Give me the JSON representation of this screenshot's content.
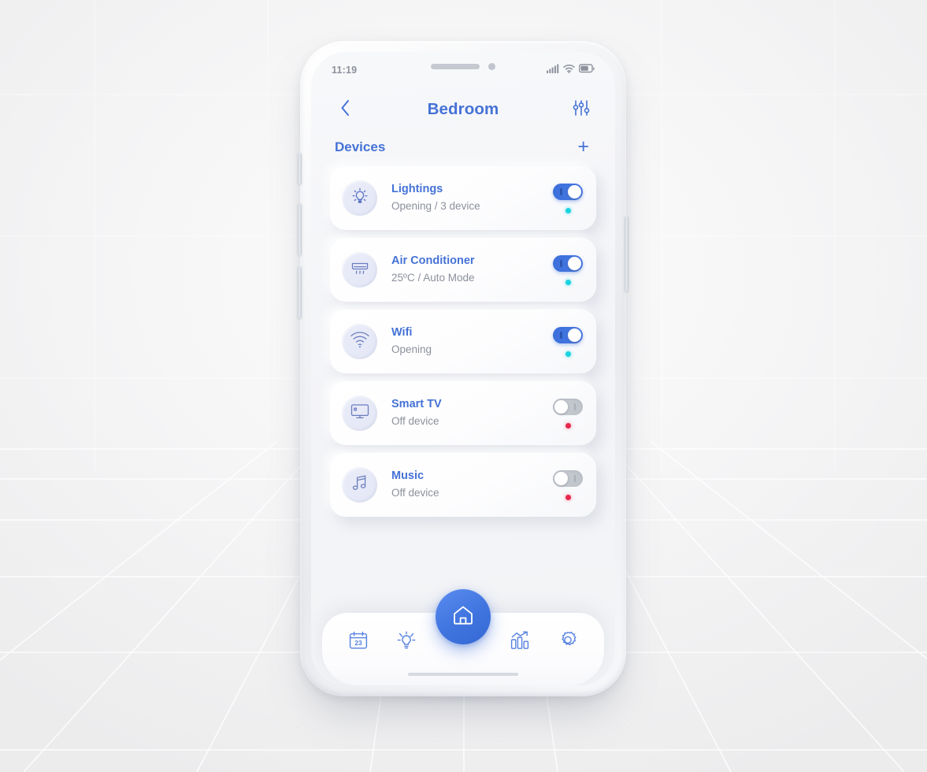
{
  "status_bar": {
    "time": "11:19",
    "icons": [
      "signal-icon",
      "wifi-icon",
      "battery-icon"
    ]
  },
  "header": {
    "back_icon": "chevron-left-icon",
    "title": "Bedroom",
    "settings_icon": "sliders-icon"
  },
  "section": {
    "title": "Devices",
    "add_label": "+"
  },
  "devices": [
    {
      "name": "Lightings",
      "status": "Opening / 3 device",
      "icon": "lightbulb-icon",
      "toggle_on": true,
      "dot": "active"
    },
    {
      "name": "Air Conditioner",
      "status": "25ºC / Auto Mode",
      "icon": "air-conditioner-icon",
      "toggle_on": true,
      "dot": "active"
    },
    {
      "name": "Wifi",
      "status": "Opening",
      "icon": "wifi-device-icon",
      "toggle_on": true,
      "dot": "active"
    },
    {
      "name": "Smart TV",
      "status": "Off device",
      "icon": "television-icon",
      "toggle_on": false,
      "dot": "inactive"
    },
    {
      "name": "Music",
      "status": "Off device",
      "icon": "music-note-icon",
      "toggle_on": false,
      "dot": "inactive"
    }
  ],
  "bottom_nav": {
    "items": [
      {
        "icon": "calendar-icon",
        "badge": "23"
      },
      {
        "icon": "lightbulb-icon",
        "badge": ""
      },
      {
        "icon": "chart-icon",
        "badge": ""
      },
      {
        "icon": "gear-icon",
        "badge": ""
      }
    ],
    "fab_icon": "home-icon"
  },
  "colors": {
    "accent": "#4572d6",
    "fab": "#3f74df",
    "status_active": "#19d3e0",
    "status_inactive": "#e8274b",
    "muted_text": "#8c909b"
  }
}
